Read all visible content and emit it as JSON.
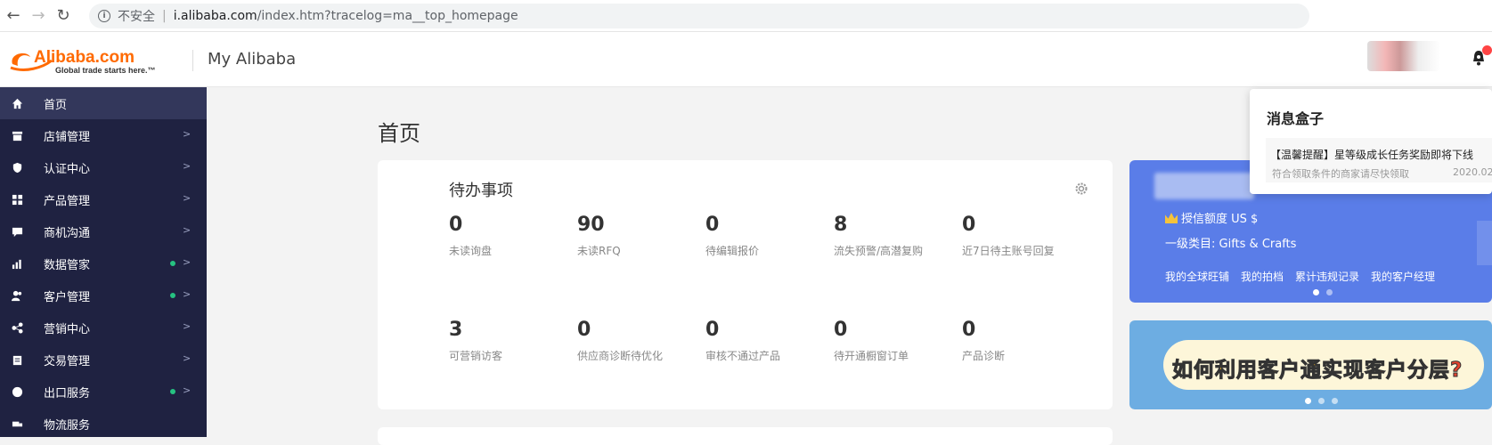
{
  "browser": {
    "security_label": "不安全",
    "url_host": "i.alibaba.com",
    "url_path": "/index.htm?tracelog=ma__top_homepage"
  },
  "header": {
    "logo_text": "Alibaba.com",
    "logo_tagline": "Global trade starts here.™",
    "title": "My Alibaba"
  },
  "sidebar": {
    "items": [
      {
        "label": "首页",
        "icon": "home-icon",
        "active": true
      },
      {
        "label": "店铺管理",
        "icon": "store-icon"
      },
      {
        "label": "认证中心",
        "icon": "shield-icon"
      },
      {
        "label": "产品管理",
        "icon": "grid-icon"
      },
      {
        "label": "商机沟通",
        "icon": "chat-icon"
      },
      {
        "label": "数据管家",
        "icon": "bar-chart-icon",
        "dot": true
      },
      {
        "label": "客户管理",
        "icon": "users-icon",
        "dot": true
      },
      {
        "label": "营销中心",
        "icon": "share-icon"
      },
      {
        "label": "交易管理",
        "icon": "clipboard-icon"
      },
      {
        "label": "出口服务",
        "icon": "globe-icon",
        "dot": true
      },
      {
        "label": "物流服务",
        "icon": "truck-icon"
      }
    ],
    "arrow": ">"
  },
  "main": {
    "page_title": "首页",
    "todo": {
      "title": "待办事项",
      "stats": [
        {
          "value": "0",
          "label": "未读询盘"
        },
        {
          "value": "90",
          "label": "未读RFQ"
        },
        {
          "value": "0",
          "label": "待编辑报价"
        },
        {
          "value": "8",
          "label": "流失预警/高潜复购"
        },
        {
          "value": "0",
          "label": "近7日待主账号回复"
        },
        {
          "value": "3",
          "label": "可营销访客"
        },
        {
          "value": "0",
          "label": "供应商诊断待优化"
        },
        {
          "value": "0",
          "label": "审核不通过产品"
        },
        {
          "value": "0",
          "label": "待开通橱窗订单"
        },
        {
          "value": "0",
          "label": "产品诊断"
        }
      ]
    }
  },
  "account_card": {
    "credit": "授信额度 US $",
    "category": "一级类目: Gifts & Crafts",
    "links": [
      "我的全球旺铺",
      "我的拍档",
      "累计违规记录",
      "我的客户经理"
    ]
  },
  "banner": {
    "text_a": "如何利用客户通",
    "text_b": "实现客户分层?"
  },
  "message_box": {
    "title": "消息盒子",
    "item_title": "【温馨提醒】星等级成长任务奖励即将下线",
    "item_sub": "符合领取条件的商家请尽快领取",
    "item_date": "2020.02"
  },
  "colors": {
    "sidebar_bg": "#1f2241",
    "accent_blue": "#5a7de8",
    "status_green": "#26c281",
    "brand_orange": "#ff6a00"
  }
}
